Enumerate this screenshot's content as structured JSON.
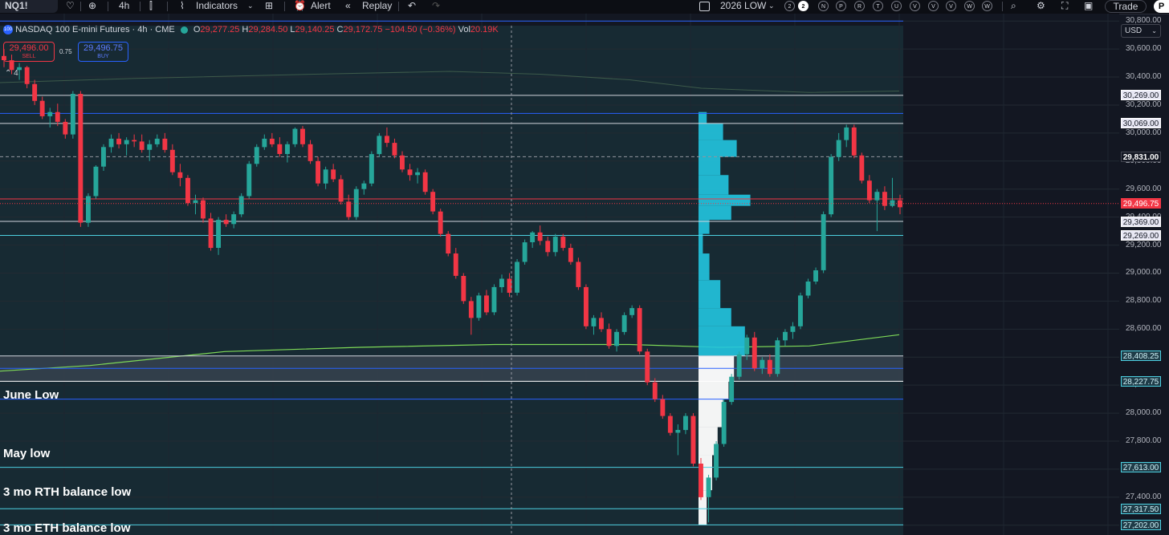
{
  "toolbar": {
    "symbol": "NQ1!",
    "interval": "4h",
    "indicators": "Indicators",
    "alert": "Alert",
    "replay": "Replay",
    "search_label": "2026 LOW",
    "circles": [
      "2",
      "2",
      "N",
      "P",
      "R",
      "T",
      "U",
      "V",
      "V",
      "V",
      "W",
      "W"
    ],
    "trade": "Trade"
  },
  "info": {
    "badge": "100",
    "name": "NASDAQ 100 E-mini Futures · 4h · CME",
    "o_label": "O",
    "o": "29,277.25",
    "h_label": "H",
    "h": "29,284.50",
    "l_label": "L",
    "l": "29,140.25",
    "c_label": "C",
    "c": "29,172.75",
    "change": "−104.50 (−0.36%)",
    "vol_label": "Vol",
    "vol": "20.19K"
  },
  "order": {
    "sell_price": "29,496.00",
    "sell_label": "SELL",
    "spread": "0.75",
    "buy_price": "29,496.75",
    "buy_label": "BUY"
  },
  "indicator_count": "4",
  "currency": "USD",
  "annotations": {
    "june_low": "June Low",
    "may_low": "May low",
    "rth_low": "3 mo RTH balance low",
    "eth_low": "3 mo ETH balance low"
  },
  "colors": {
    "background": "#131722",
    "up": "#26a69a",
    "down": "#f23645",
    "profile": "#22c5e0",
    "ma": "#7ed957"
  },
  "chart_data": {
    "type": "candlestick",
    "title": "NASDAQ 100 E-mini Futures · 4h · CME",
    "y_ticks": [
      30800,
      30600,
      30400,
      30200,
      30000,
      29800,
      29600,
      29400,
      29200,
      29000,
      28800,
      28600,
      28400,
      28200,
      28000,
      27800,
      27600,
      27400,
      27200
    ],
    "y_tick_labels": [
      "30,800.00",
      "30,600.00",
      "30,400.00",
      "30,200.00",
      "30,000.00",
      "29,800.00",
      "29,600.00",
      "29,400.00",
      "29,200.00",
      "29,000.00",
      "28,800.00",
      "28,600.00",
      "28,400.00",
      "28,200.00",
      "28,000.00",
      "27,800.00",
      "27,600.00",
      "27,400.00",
      "27,200.00"
    ],
    "ylim": [
      27130,
      30950
    ],
    "price_labels": [
      {
        "value": 30269.0,
        "text": "30,269.00",
        "kind": "white"
      },
      {
        "value": 30069.0,
        "text": "30,069.00",
        "kind": "white"
      },
      {
        "value": 29831.0,
        "text": "29,831.00",
        "kind": "dark"
      },
      {
        "value": 29496.75,
        "text": "29,496.75",
        "kind": "red"
      },
      {
        "value": 29369.0,
        "text": "29,369.00",
        "kind": "white"
      },
      {
        "value": 29269.0,
        "text": "29,269.00",
        "kind": "white"
      },
      {
        "value": 28408.25,
        "text": "28,408.25",
        "kind": "cyan"
      },
      {
        "value": 28227.75,
        "text": "28,227.75",
        "kind": "cyan"
      },
      {
        "value": 27613.0,
        "text": "27,613.00",
        "kind": "cyan"
      },
      {
        "value": 27317.5,
        "text": "27,317.50",
        "kind": "cyan"
      },
      {
        "value": 27202.0,
        "text": "27,202.00",
        "kind": "cyan"
      }
    ],
    "levels": [
      {
        "value": 30800,
        "color": "#2962ff"
      },
      {
        "value": 30269,
        "color": "#d1d4dc"
      },
      {
        "value": 30140,
        "color": "#2962ff"
      },
      {
        "value": 30069,
        "color": "#d1d4dc"
      },
      {
        "value": 29831,
        "color": "#9598a1",
        "dash": true
      },
      {
        "value": 29530,
        "color": "#f23645"
      },
      {
        "value": 29369,
        "color": "#d1d4dc"
      },
      {
        "value": 29269,
        "color": "#4dd0e1"
      },
      {
        "value": 28408.25,
        "color": "#d1d4dc"
      },
      {
        "value": 28320,
        "color": "#2962ff"
      },
      {
        "value": 28227.75,
        "color": "#ffffff"
      },
      {
        "value": 28100,
        "color": "#2962ff"
      },
      {
        "value": 27613,
        "color": "#4dd0e1"
      },
      {
        "value": 27317.5,
        "color": "#4dd0e1"
      },
      {
        "value": 27202,
        "color": "#4dd0e1"
      }
    ],
    "candles": [
      [
        30550,
        30600,
        30470,
        30520
      ],
      [
        30520,
        30560,
        30420,
        30450
      ],
      [
        30450,
        30500,
        30380,
        30470
      ],
      [
        30470,
        30480,
        30320,
        30350
      ],
      [
        30350,
        30380,
        30200,
        30230
      ],
      [
        30230,
        30260,
        30100,
        30120
      ],
      [
        30120,
        30180,
        30040,
        30150
      ],
      [
        30150,
        30210,
        30050,
        30080
      ],
      [
        30080,
        30100,
        29960,
        29990
      ],
      [
        29990,
        30300,
        29960,
        30280
      ],
      [
        30280,
        30300,
        29330,
        29360
      ],
      [
        29360,
        29570,
        29330,
        29550
      ],
      [
        29550,
        29770,
        29530,
        29760
      ],
      [
        29760,
        29920,
        29730,
        29900
      ],
      [
        29900,
        29990,
        29860,
        29960
      ],
      [
        29960,
        30000,
        29890,
        29920
      ],
      [
        29920,
        29970,
        29840,
        29950
      ],
      [
        29950,
        29990,
        29900,
        29940
      ],
      [
        29940,
        29990,
        29860,
        29880
      ],
      [
        29880,
        29950,
        29800,
        29920
      ],
      [
        29920,
        29990,
        29900,
        29960
      ],
      [
        29960,
        30000,
        29860,
        29880
      ],
      [
        29880,
        29920,
        29700,
        29720
      ],
      [
        29720,
        29780,
        29620,
        29680
      ],
      [
        29680,
        29700,
        29480,
        29500
      ],
      [
        29500,
        29560,
        29420,
        29520
      ],
      [
        29520,
        29540,
        29360,
        29390
      ],
      [
        29390,
        29430,
        29160,
        29180
      ],
      [
        29180,
        29400,
        29130,
        29380
      ],
      [
        29380,
        29420,
        29330,
        29350
      ],
      [
        29350,
        29440,
        29320,
        29420
      ],
      [
        29420,
        29570,
        29400,
        29550
      ],
      [
        29550,
        29800,
        29530,
        29780
      ],
      [
        29780,
        29920,
        29760,
        29900
      ],
      [
        29900,
        29990,
        29880,
        29960
      ],
      [
        29960,
        30000,
        29900,
        29920
      ],
      [
        29920,
        29970,
        29830,
        29850
      ],
      [
        29850,
        29940,
        29790,
        29920
      ],
      [
        29920,
        30040,
        29900,
        30030
      ],
      [
        30030,
        30050,
        29900,
        29920
      ],
      [
        29920,
        29950,
        29780,
        29800
      ],
      [
        29800,
        29830,
        29620,
        29640
      ],
      [
        29640,
        29760,
        29600,
        29740
      ],
      [
        29740,
        29780,
        29650,
        29670
      ],
      [
        29670,
        29700,
        29490,
        29510
      ],
      [
        29510,
        29560,
        29380,
        29400
      ],
      [
        29400,
        29620,
        29380,
        29600
      ],
      [
        29600,
        29660,
        29560,
        29640
      ],
      [
        29640,
        29870,
        29620,
        29850
      ],
      [
        29850,
        30000,
        29830,
        29980
      ],
      [
        29980,
        30040,
        29900,
        29930
      ],
      [
        29930,
        29960,
        29820,
        29840
      ],
      [
        29840,
        29870,
        29720,
        29740
      ],
      [
        29740,
        29780,
        29660,
        29700
      ],
      [
        29700,
        29750,
        29640,
        29720
      ],
      [
        29720,
        29740,
        29560,
        29580
      ],
      [
        29580,
        29600,
        29420,
        29440
      ],
      [
        29440,
        29460,
        29260,
        29280
      ],
      [
        29280,
        29300,
        29120,
        29140
      ],
      [
        29140,
        29180,
        28960,
        28980
      ],
      [
        28980,
        29000,
        28780,
        28800
      ],
      [
        28800,
        28830,
        28560,
        28680
      ],
      [
        28680,
        28860,
        28660,
        28840
      ],
      [
        28840,
        28880,
        28700,
        28720
      ],
      [
        28720,
        28920,
        28700,
        28900
      ],
      [
        28900,
        28990,
        28860,
        28960
      ],
      [
        28960,
        29000,
        28830,
        28860
      ],
      [
        28860,
        29100,
        28840,
        29080
      ],
      [
        29080,
        29240,
        29060,
        29220
      ],
      [
        29220,
        29300,
        29180,
        29290
      ],
      [
        29290,
        29340,
        29200,
        29230
      ],
      [
        29230,
        29260,
        29120,
        29150
      ],
      [
        29150,
        29280,
        29120,
        29260
      ],
      [
        29260,
        29280,
        29160,
        29180
      ],
      [
        29180,
        29210,
        29060,
        29080
      ],
      [
        29080,
        29110,
        28880,
        28900
      ],
      [
        28900,
        28920,
        28600,
        28620
      ],
      [
        28620,
        28700,
        28560,
        28680
      ],
      [
        28680,
        28720,
        28580,
        28600
      ],
      [
        28600,
        28640,
        28460,
        28480
      ],
      [
        28480,
        28600,
        28440,
        28580
      ],
      [
        28580,
        28720,
        28560,
        28700
      ],
      [
        28700,
        28770,
        28680,
        28750
      ],
      [
        28750,
        28770,
        28420,
        28440
      ],
      [
        28440,
        28460,
        28200,
        28220
      ],
      [
        28220,
        28250,
        28080,
        28100
      ],
      [
        28100,
        28130,
        27960,
        27980
      ],
      [
        27980,
        28000,
        27840,
        27860
      ],
      [
        27860,
        27920,
        27700,
        27880
      ],
      [
        27880,
        28000,
        27850,
        27980
      ],
      [
        27980,
        28000,
        27620,
        27640
      ],
      [
        27640,
        27680,
        27380,
        27400
      ],
      [
        27400,
        27560,
        27220,
        27540
      ],
      [
        27540,
        27800,
        27520,
        27780
      ],
      [
        27780,
        28100,
        27760,
        28080
      ],
      [
        28080,
        28280,
        28060,
        28260
      ],
      [
        28260,
        28440,
        28240,
        28420
      ],
      [
        28420,
        28560,
        28380,
        28540
      ],
      [
        28540,
        28580,
        28300,
        28320
      ],
      [
        28320,
        28400,
        28280,
        28380
      ],
      [
        28380,
        28420,
        28260,
        28280
      ],
      [
        28280,
        28540,
        28260,
        28520
      ],
      [
        28520,
        28600,
        28480,
        28580
      ],
      [
        28580,
        28650,
        28530,
        28620
      ],
      [
        28620,
        28860,
        28600,
        28840
      ],
      [
        28840,
        28960,
        28820,
        28940
      ],
      [
        28940,
        29040,
        28920,
        29020
      ],
      [
        29020,
        29440,
        29000,
        29420
      ],
      [
        29420,
        29850,
        29400,
        29830
      ],
      [
        29830,
        30000,
        29800,
        29950
      ],
      [
        29950,
        30060,
        29900,
        30040
      ],
      [
        30040,
        30060,
        29820,
        29840
      ],
      [
        29840,
        29860,
        29640,
        29660
      ],
      [
        29660,
        29700,
        29500,
        29520
      ],
      [
        29520,
        29600,
        29300,
        29580
      ],
      [
        29580,
        29620,
        29450,
        29480
      ],
      [
        29480,
        29680,
        29470,
        29520
      ],
      [
        29520,
        29560,
        29420,
        29470
      ]
    ],
    "ma_upper": [
      [
        0,
        30360
      ],
      [
        0.15,
        30390
      ],
      [
        0.35,
        30420
      ],
      [
        0.5,
        30440
      ],
      [
        0.6,
        30420
      ],
      [
        0.7,
        30380
      ],
      [
        0.78,
        30320
      ],
      [
        0.9,
        30290
      ],
      [
        1,
        30300
      ]
    ],
    "ma_lower": [
      [
        0,
        28300
      ],
      [
        0.1,
        28340
      ],
      [
        0.25,
        28440
      ],
      [
        0.4,
        28470
      ],
      [
        0.55,
        28490
      ],
      [
        0.7,
        28490
      ],
      [
        0.8,
        28470
      ],
      [
        0.9,
        28480
      ],
      [
        1,
        28560
      ]
    ],
    "volume_profile": [
      {
        "low": 30069,
        "high": 30150,
        "w": 0.15,
        "c": "cyan"
      },
      {
        "low": 29950,
        "high": 30069,
        "w": 0.45,
        "c": "cyan"
      },
      {
        "low": 29830,
        "high": 29950,
        "w": 0.7,
        "c": "cyan"
      },
      {
        "low": 29700,
        "high": 29830,
        "w": 0.4,
        "c": "cyan"
      },
      {
        "low": 29560,
        "high": 29700,
        "w": 0.55,
        "c": "cyan"
      },
      {
        "low": 29480,
        "high": 29560,
        "w": 0.95,
        "c": "cyan"
      },
      {
        "low": 29380,
        "high": 29480,
        "w": 0.6,
        "c": "cyan"
      },
      {
        "low": 29280,
        "high": 29380,
        "w": 0.2,
        "c": "cyan"
      },
      {
        "low": 29140,
        "high": 29280,
        "w": 0.08,
        "c": "cyan"
      },
      {
        "low": 28950,
        "high": 29140,
        "w": 0.2,
        "c": "cyan"
      },
      {
        "low": 28750,
        "high": 28950,
        "w": 0.4,
        "c": "cyan"
      },
      {
        "low": 28620,
        "high": 28750,
        "w": 0.6,
        "c": "cyan"
      },
      {
        "low": 28408,
        "high": 28620,
        "w": 0.85,
        "c": "cyan"
      },
      {
        "low": 28228,
        "high": 28408,
        "w": 0.65,
        "c": "white"
      },
      {
        "low": 28100,
        "high": 28228,
        "w": 0.55,
        "c": "white"
      },
      {
        "low": 27900,
        "high": 28100,
        "w": 0.45,
        "c": "white"
      },
      {
        "low": 27700,
        "high": 27900,
        "w": 0.35,
        "c": "white"
      },
      {
        "low": 27450,
        "high": 27700,
        "w": 0.25,
        "c": "white"
      },
      {
        "low": 27200,
        "high": 27450,
        "w": 0.15,
        "c": "white"
      }
    ]
  }
}
